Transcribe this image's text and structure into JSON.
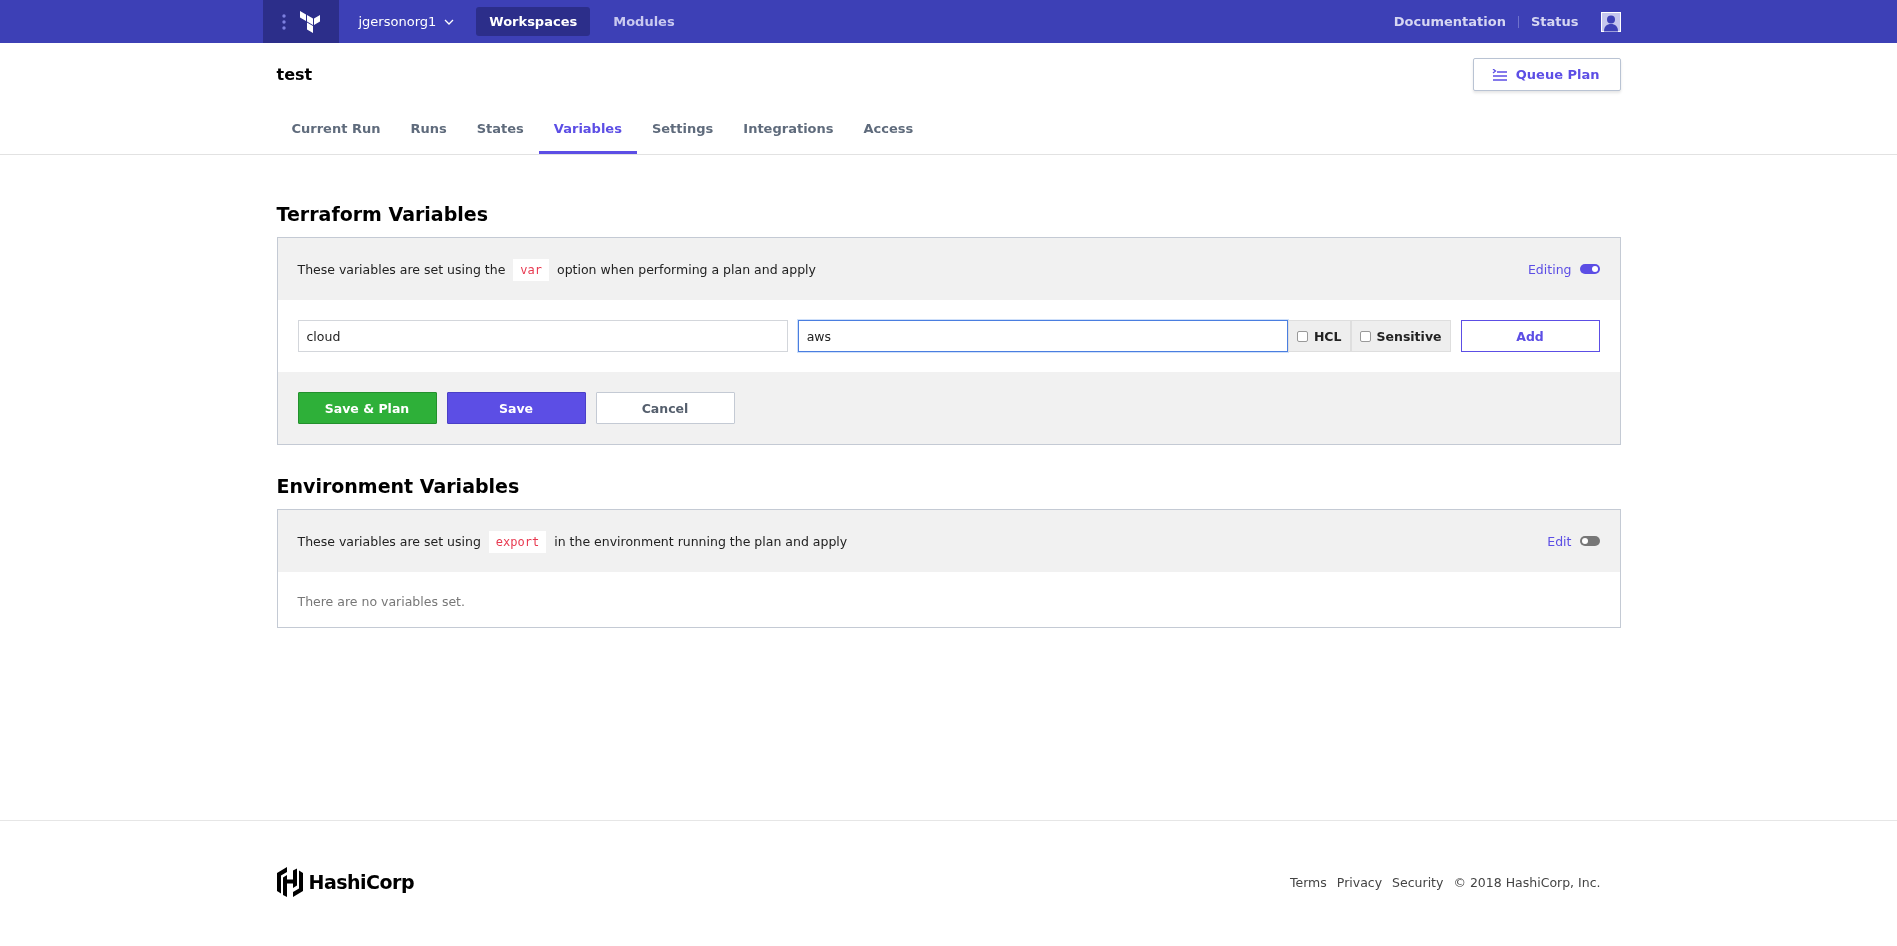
{
  "nav": {
    "org": "jgersonorg1",
    "links": [
      {
        "label": "Workspaces",
        "selected": true
      },
      {
        "label": "Modules",
        "selected": false
      }
    ],
    "right_links": [
      "Documentation",
      "Status"
    ]
  },
  "workspace": {
    "title": "test",
    "queue_button": "Queue Plan"
  },
  "tabs": [
    {
      "label": "Current Run",
      "selected": false
    },
    {
      "label": "Runs",
      "selected": false
    },
    {
      "label": "States",
      "selected": false
    },
    {
      "label": "Variables",
      "selected": true
    },
    {
      "label": "Settings",
      "selected": false
    },
    {
      "label": "Integrations",
      "selected": false
    },
    {
      "label": "Access",
      "selected": false
    }
  ],
  "sections": [
    {
      "kind": "editor",
      "title": "Terraform Variables",
      "description": {
        "before": "These variables are set using the",
        "code": "var",
        "after": "option when performing a plan and apply"
      },
      "toggle": {
        "label": "Editing",
        "on": true
      },
      "fields": [
        {
          "value": "cloud",
          "focused": false
        },
        {
          "value": "aws",
          "focused": true
        }
      ],
      "checkboxes": [
        {
          "label": "HCL",
          "checked": false
        },
        {
          "label": "Sensitive",
          "checked": false
        }
      ],
      "add_button": "Add",
      "actions": [
        {
          "label": "Save & Plan",
          "kind": "success"
        },
        {
          "label": "Save",
          "kind": "primary"
        },
        {
          "label": "Cancel",
          "kind": "secondary"
        }
      ]
    },
    {
      "kind": "empty",
      "title": "Environment Variables",
      "description": {
        "before": "These variables are set using",
        "code": "export",
        "after": "in the environment running the plan and apply"
      },
      "toggle": {
        "label": "Edit",
        "on": false
      },
      "empty_text": "There are no variables set."
    }
  ],
  "footer": {
    "brand": "HashiCorp",
    "links": [
      "Terms",
      "Privacy",
      "Security"
    ],
    "copyright": "© 2018 HashiCorp, Inc."
  }
}
